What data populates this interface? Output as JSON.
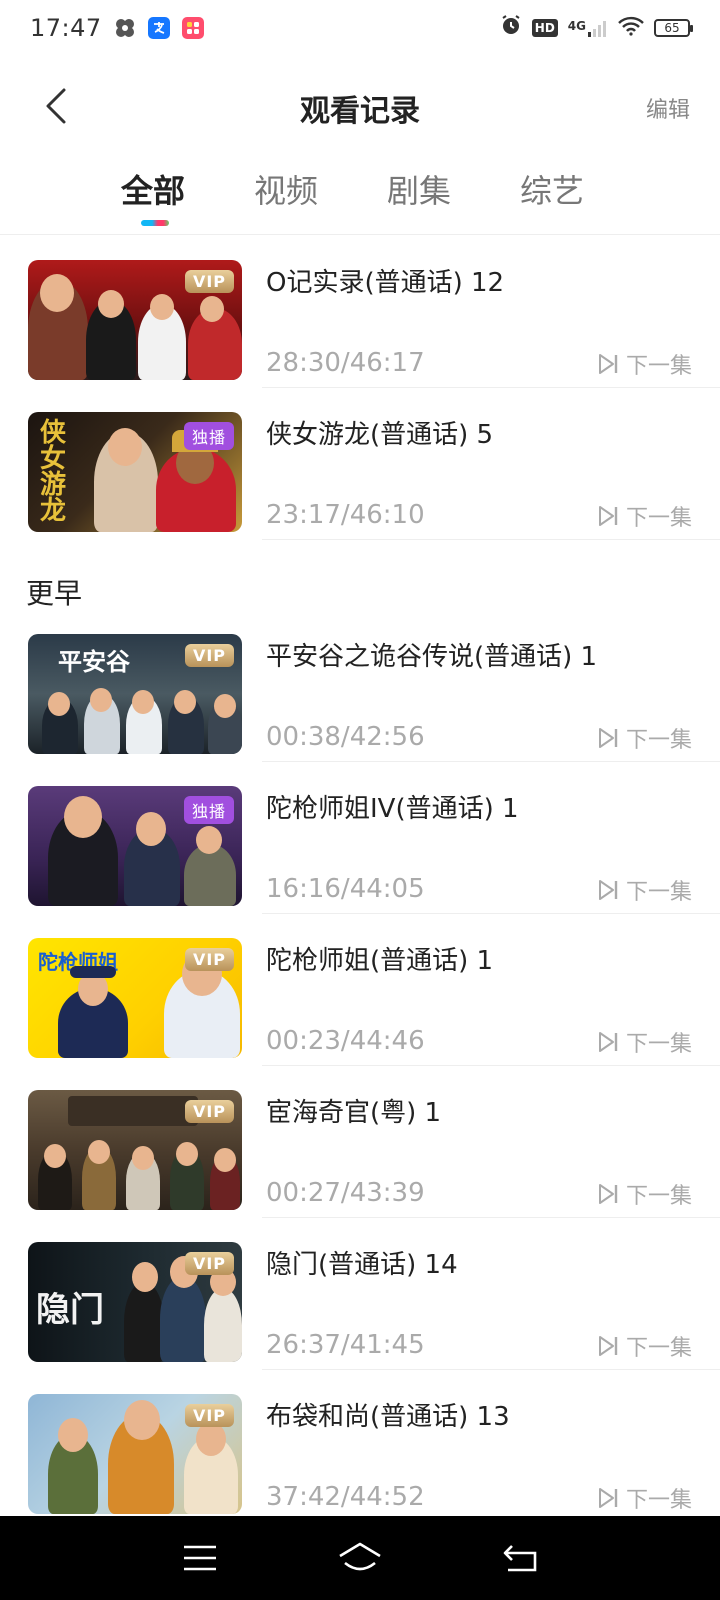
{
  "status": {
    "time": "17:47",
    "network": "4G",
    "hd": "HD",
    "battery": "65"
  },
  "header": {
    "title": "观看记录",
    "edit_label": "编辑"
  },
  "tabs": [
    {
      "label": "全部",
      "active": true
    },
    {
      "label": "视频",
      "active": false
    },
    {
      "label": "剧集",
      "active": false
    },
    {
      "label": "综艺",
      "active": false
    }
  ],
  "section_earlier": "更早",
  "next_label": "下一集",
  "items": [
    {
      "title": "O记实录(普通话) 12",
      "progress": "28:30/46:17",
      "badge": "VIP"
    },
    {
      "title": "侠女游龙(普通话) 5",
      "progress": "23:17/46:10",
      "badge": "独播"
    },
    {
      "title": "平安谷之诡谷传说(普通话) 1",
      "progress": "00:38/42:56",
      "badge": "VIP"
    },
    {
      "title": "陀枪师姐IV(普通话) 1",
      "progress": "16:16/44:05",
      "badge": "独播"
    },
    {
      "title": "陀枪师姐(普通话) 1",
      "progress": "00:23/44:46",
      "badge": "VIP"
    },
    {
      "title": "宦海奇官(粤) 1",
      "progress": "00:27/43:39",
      "badge": "VIP"
    },
    {
      "title": "隐门(普通话) 14",
      "progress": "26:37/41:45",
      "badge": "VIP"
    },
    {
      "title": "布袋和尚(普通话) 13",
      "progress": "37:42/44:52",
      "badge": "VIP"
    }
  ],
  "thumb_text": {
    "item2": "侠女游龙",
    "item3": "平安谷",
    "item5": "陀枪师姐",
    "item7": "隐门"
  }
}
